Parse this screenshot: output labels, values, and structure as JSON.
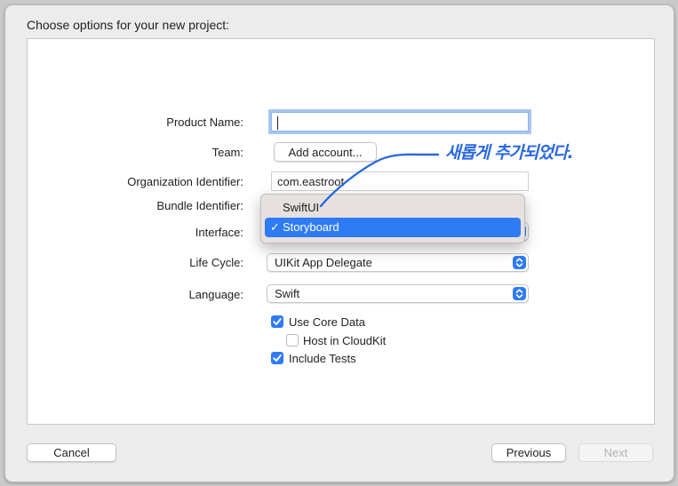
{
  "dialog": {
    "header": "Choose options for your new project:",
    "fields": {
      "product_name": {
        "label": "Product Name:",
        "value": ""
      },
      "team": {
        "label": "Team:",
        "button": "Add account..."
      },
      "organization_identifier": {
        "label": "Organization Identifier:",
        "value": "com.eastroot"
      },
      "bundle_identifier": {
        "label": "Bundle Identifier:"
      },
      "interface": {
        "label": "Interface:",
        "options": [
          "SwiftUI",
          "Storyboard"
        ],
        "selected": "Storyboard",
        "check": "✓"
      },
      "life_cycle": {
        "label": "Life Cycle:",
        "value": "UIKit App Delegate"
      },
      "language": {
        "label": "Language:",
        "value": "Swift"
      }
    },
    "checkboxes": {
      "use_core_data": {
        "label": "Use Core Data",
        "checked": true
      },
      "host_in_cloudkit": {
        "label": "Host in CloudKit",
        "checked": false
      },
      "include_tests": {
        "label": "Include Tests",
        "checked": true
      }
    },
    "buttons": {
      "cancel": "Cancel",
      "previous": "Previous",
      "next": "Next"
    }
  },
  "annotation": {
    "text": "새롭게 추가되었다."
  },
  "colors": {
    "accent": "#2f7bf5",
    "annotation": "#2968e0",
    "background": "#ececec"
  }
}
